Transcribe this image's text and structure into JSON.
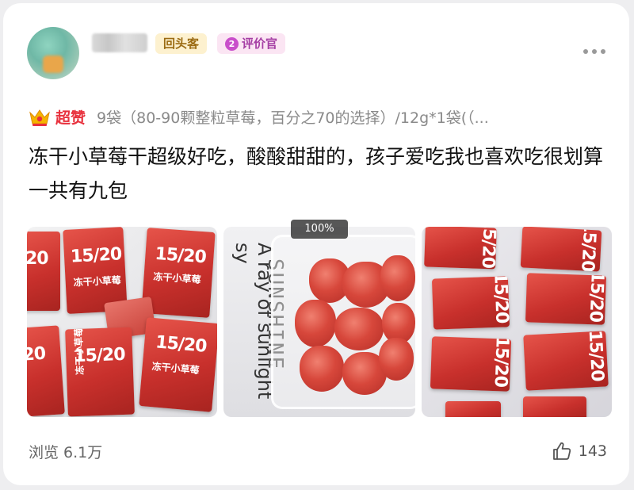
{
  "header": {
    "badge_return": "回头客",
    "badge_reviewer_level": "2",
    "badge_reviewer": "评价官"
  },
  "rating": {
    "icon": "crown-icon",
    "label": "超赞",
    "sku": "9袋（80-90颗整粒草莓，百分之70的选择）/12g*1袋(（..."
  },
  "review": {
    "text": "冻干小草莓干超级好吃，酸酸甜甜的，孩子爱吃我也喜欢吃很划算一共有九包"
  },
  "photos": {
    "zoom": "100%",
    "bag_number": "15/20",
    "bag_name": "冻干小草莓",
    "bag_number_partial": "20",
    "sign_text_1": "A ray of sunlight sy",
    "sign_text_2": "SUNSHINE"
  },
  "footer": {
    "views": "浏览 6.1万",
    "likes": "143"
  },
  "colors": {
    "accent_red": "#e8313d",
    "badge_gold_bg": "#fdf1cf",
    "badge_purple_bg": "#fbe5f3"
  }
}
